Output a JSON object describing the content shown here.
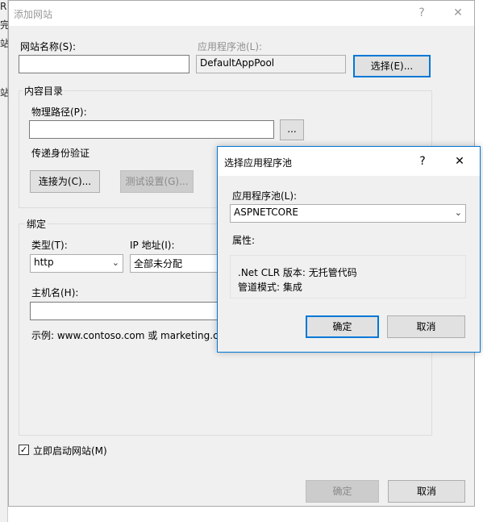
{
  "background": {
    "fragments": [
      "R",
      "完",
      "站",
      "站"
    ]
  },
  "dialog": {
    "title": "添加网站",
    "help_glyph": "?",
    "close_glyph": "✕",
    "site_name_label": "网站名称(S):",
    "site_name_value": "",
    "app_pool_label": "应用程序池(L):",
    "app_pool_value": "DefaultAppPool",
    "select_button": "选择(E)...",
    "content_dir": {
      "group_label": "内容目录",
      "physical_path_label": "物理路径(P):",
      "physical_path_value": "",
      "browse_button": "...",
      "pass_auth_label": "传递身份验证",
      "connect_as_button": "连接为(C)...",
      "test_settings_button": "测试设置(G)..."
    },
    "binding": {
      "group_label": "绑定",
      "type_label": "类型(T):",
      "type_value": "http",
      "ip_label": "IP 地址(I):",
      "ip_value": "全部未分配",
      "hostname_label": "主机名(H):",
      "hostname_value": "",
      "example_text": "示例: www.contoso.com 或 marketing.contoso.com"
    },
    "start_now_label": "立即启动网站(M)",
    "start_now_checked": true,
    "ok_button": "确定",
    "cancel_button": "取消"
  },
  "popup": {
    "title": "选择应用程序池",
    "help_glyph": "?",
    "close_glyph": "✕",
    "pool_label": "应用程序池(L):",
    "pool_value": "ASPNETCORE",
    "properties_label": "属性:",
    "clr_version": ".Net CLR 版本: 无托管代码",
    "pipeline_mode": "管道模式: 集成",
    "ok_button": "确定",
    "cancel_button": "取消"
  },
  "icons": {
    "dropdown": "chevron-down-icon",
    "checkmark": "checkmark-icon"
  },
  "colors": {
    "accent": "#0078d7",
    "window_bg": "#f0f0f0",
    "disabled_text": "#909090"
  }
}
